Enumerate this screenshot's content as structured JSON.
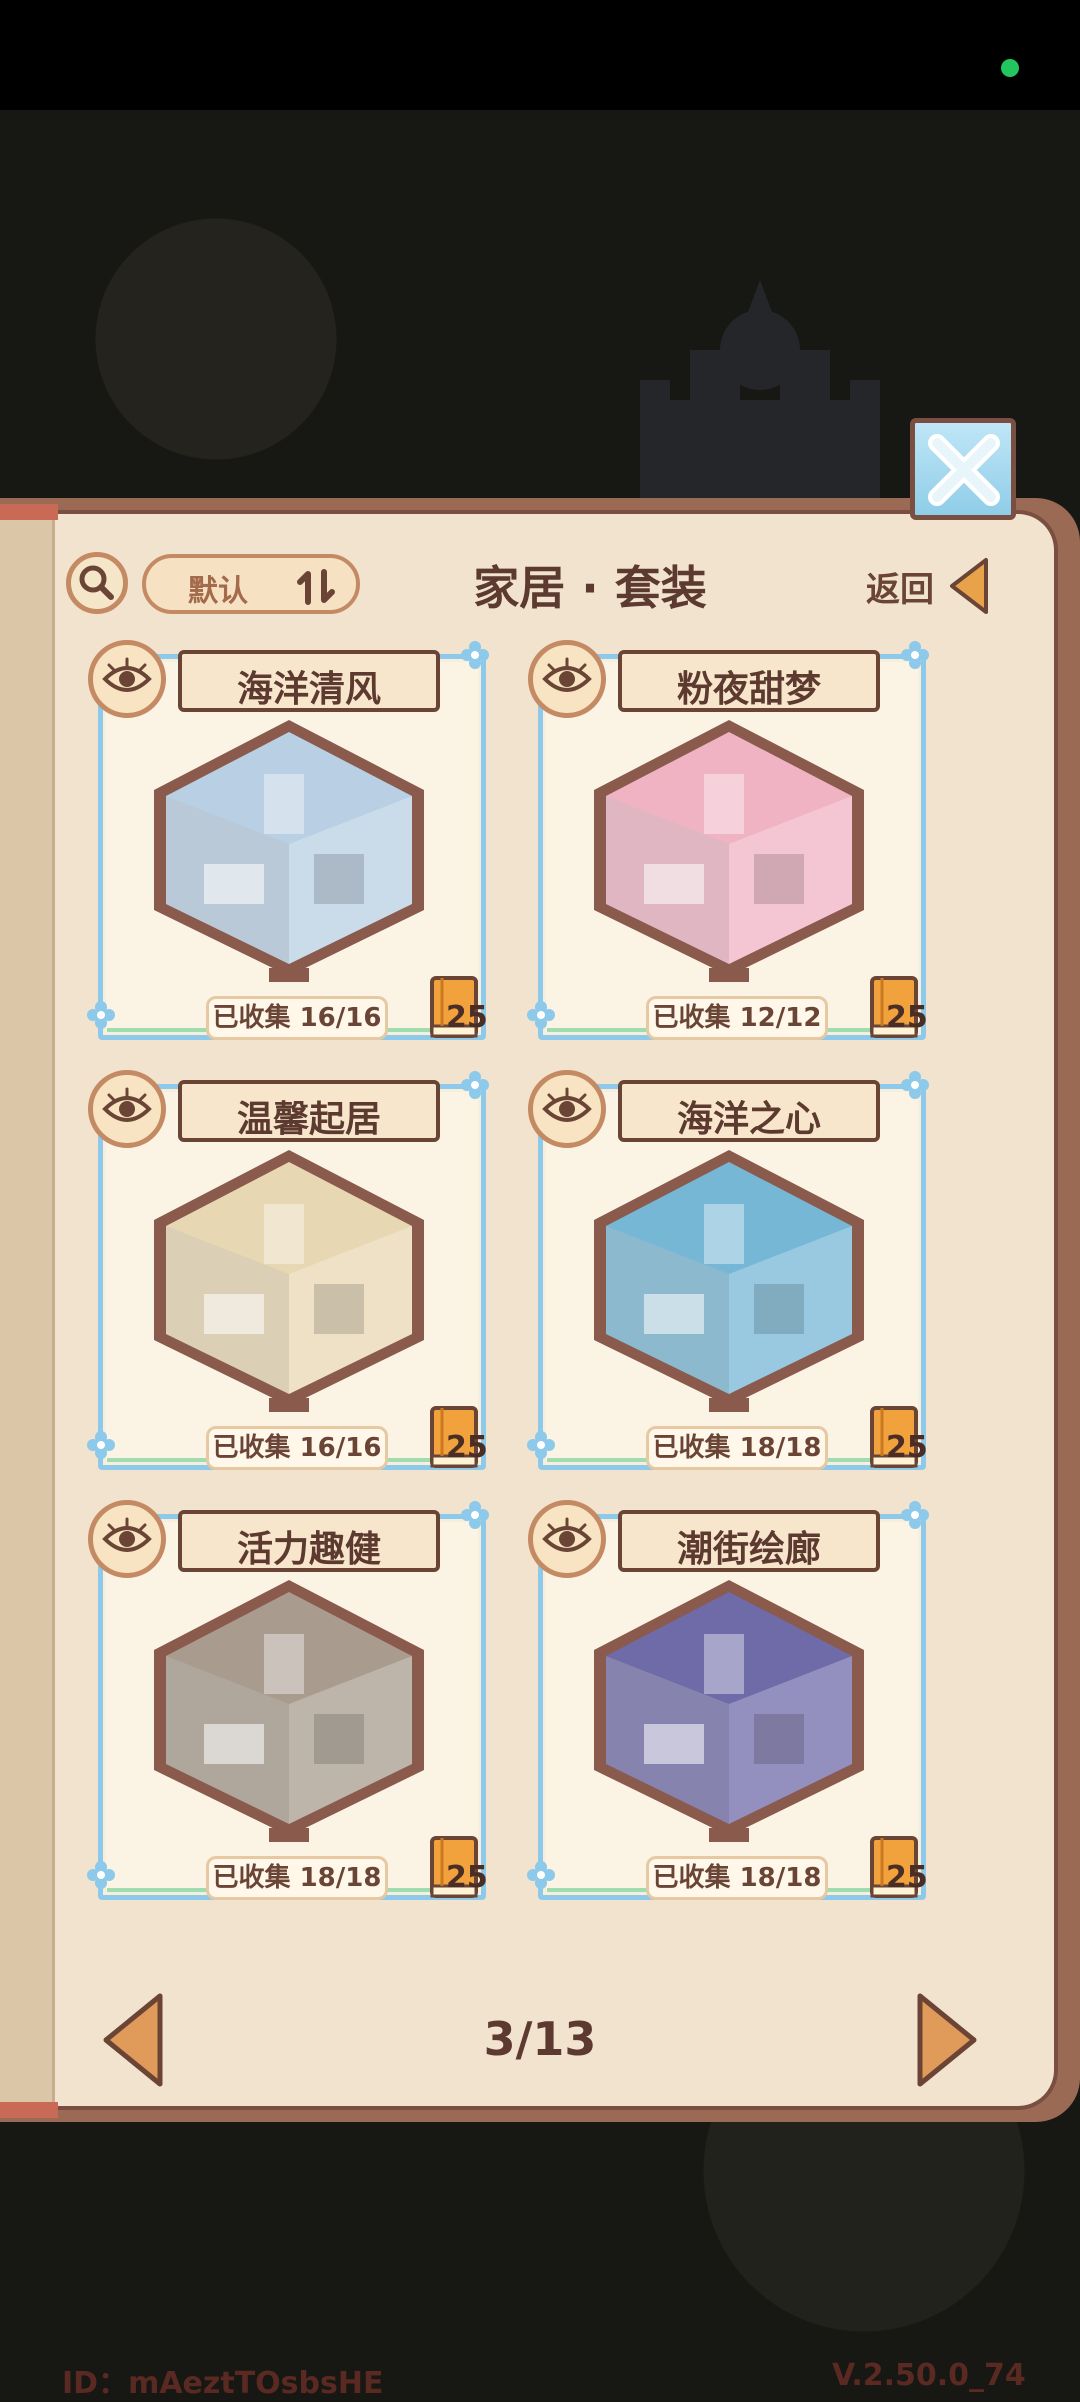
{
  "header": {
    "title": "家居 · 套装",
    "sort_label": "默认",
    "back_label": "返回"
  },
  "cards": [
    {
      "name": "海洋清风",
      "collected": "已收集 16/16",
      "books": "25",
      "theme": "#b9cfe3"
    },
    {
      "name": "粉夜甜梦",
      "collected": "已收集 12/12",
      "books": "25",
      "theme": "#f0b3c4"
    },
    {
      "name": "温馨起居",
      "collected": "已收集 16/16",
      "books": "25",
      "theme": "#e8d7b3"
    },
    {
      "name": "海洋之心",
      "collected": "已收集 18/18",
      "books": "25",
      "theme": "#76b7d6"
    },
    {
      "name": "活力趣健",
      "collected": "已收集 18/18",
      "books": "25",
      "theme": "#a99c8e"
    },
    {
      "name": "潮街绘廊",
      "collected": "已收集 18/18",
      "books": "25",
      "theme": "#6f6aa8"
    }
  ],
  "pager": {
    "page": "3/13"
  },
  "footer": {
    "id": "ID：mAeztTOsbsHE",
    "version": "V.2.50.0_74"
  },
  "icons": {
    "search": "search-icon",
    "sort": "sort-icon",
    "back": "back-arrow-icon",
    "eye": "eye-icon",
    "book": "book-icon",
    "close": "close-icon",
    "prev": "prev-arrow-icon",
    "next": "next-arrow-icon"
  },
  "colors": {
    "page": "#f1e3cd",
    "frame": "#8cc9ea",
    "text": "#5c3a30",
    "accent": "#c48a63",
    "book": "#f2a23c"
  }
}
